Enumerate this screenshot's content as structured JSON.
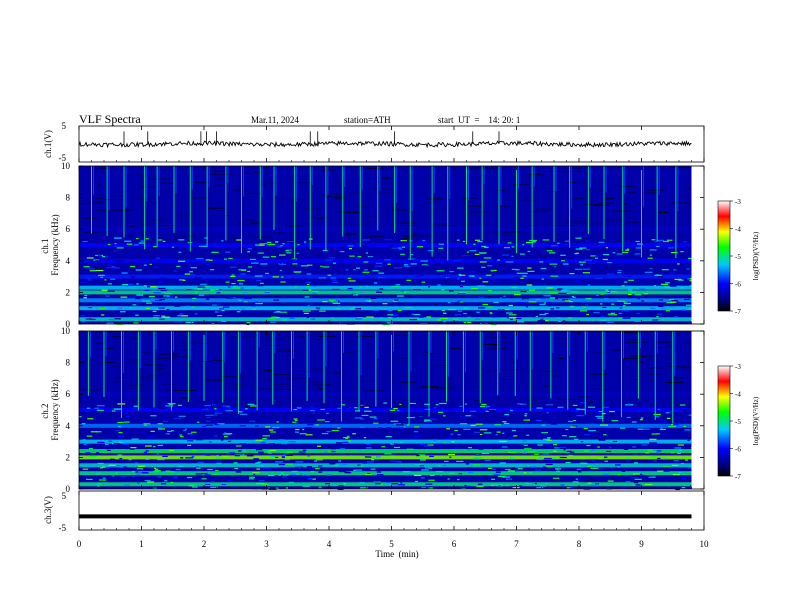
{
  "header": {
    "title": "VLF  Spectra",
    "date": "Mar.11, 2024",
    "station": "station=ATH",
    "start": "start  UT  =    14: 20: 1"
  },
  "chart_data": [
    {
      "type": "line",
      "panel": "ch1-voltage",
      "ylabel": "ch.1(V)",
      "yticks": [
        "5",
        "-5"
      ],
      "ylim": [
        -5,
        5
      ],
      "xlim": [
        0,
        10
      ],
      "series": [
        {
          "baseline": 0,
          "approx_noise": 0.6
        }
      ],
      "spikes_min": [
        0.72,
        1.1,
        1.95,
        2.04,
        2.2,
        3.7,
        3.82,
        5.05,
        6.3,
        6.72
      ]
    },
    {
      "type": "heatmap",
      "panel": "ch1-spectrogram",
      "ylabel": "ch.1\nFrequency  (kHz)",
      "yticks": [
        "10",
        "8",
        "6",
        "4",
        "2",
        "0"
      ],
      "ylim": [
        0,
        10
      ],
      "xlim": [
        0,
        9.8
      ],
      "colorbar": {
        "label": "log(PSD)(V²/Hz)",
        "ticks": [
          "-3",
          "-4",
          "-5",
          "-6",
          "-7"
        ],
        "range": [
          -7,
          -3
        ]
      },
      "bands_khz": [
        {
          "f": 0.3,
          "level": -5.2
        },
        {
          "f": 1.0,
          "level": -5.3
        },
        {
          "f": 1.5,
          "level": -5.5
        },
        {
          "f": 2.0,
          "level": -5.0
        },
        {
          "f": 2.3,
          "level": -5.3
        },
        {
          "f": 3.0,
          "level": -5.9
        },
        {
          "f": 4.0,
          "level": -6.0
        },
        {
          "f": 5.0,
          "level": -6.0
        },
        {
          "f": 6.0,
          "level": -6.3
        }
      ],
      "sferics_min": [
        0.2,
        0.45,
        0.72,
        1.05,
        1.25,
        1.52,
        1.78,
        2.05,
        2.35,
        2.6,
        2.9,
        3.12,
        3.45,
        3.7,
        3.95,
        4.22,
        4.5,
        4.78,
        5.05,
        5.3,
        5.65,
        5.9,
        6.2,
        6.45,
        6.72,
        7.0,
        7.25,
        7.6,
        7.85,
        8.15,
        8.4,
        8.7,
        9.0,
        9.25,
        9.55
      ]
    },
    {
      "type": "heatmap",
      "panel": "ch2-spectrogram",
      "ylabel": "ch.2\nFrequency  (kHz)",
      "yticks": [
        "10",
        "8",
        "6",
        "4",
        "2",
        "0"
      ],
      "ylim": [
        0,
        10
      ],
      "xlim": [
        0,
        9.8
      ],
      "colorbar": {
        "label": "log(PSD)(V²/Hz)",
        "ticks": [
          "-3",
          "-4",
          "-5",
          "-6",
          "-7"
        ],
        "range": [
          -7,
          -3
        ]
      },
      "bands_khz": [
        {
          "f": 0.3,
          "level": -5.0
        },
        {
          "f": 1.0,
          "level": -5.0
        },
        {
          "f": 1.5,
          "level": -5.2
        },
        {
          "f": 2.0,
          "level": -4.4
        },
        {
          "f": 2.4,
          "level": -4.9
        },
        {
          "f": 3.0,
          "level": -5.3
        },
        {
          "f": 4.0,
          "level": -5.6
        },
        {
          "f": 5.0,
          "level": -6.0
        },
        {
          "f": 6.0,
          "level": -6.3
        }
      ],
      "sferics_min": [
        0.15,
        0.4,
        0.68,
        0.95,
        1.2,
        1.48,
        1.75,
        2.0,
        2.3,
        2.55,
        2.85,
        3.1,
        3.4,
        3.65,
        3.92,
        4.2,
        4.48,
        4.75,
        5.0,
        5.28,
        5.6,
        5.88,
        6.15,
        6.42,
        6.7,
        6.98,
        7.22,
        7.55,
        7.82,
        8.1,
        8.38,
        8.68,
        8.95,
        9.22,
        9.5
      ]
    },
    {
      "type": "line",
      "panel": "ch3-voltage",
      "ylabel": "ch.3(V)",
      "yticks": [
        "5",
        "-5"
      ],
      "ylim": [
        -5,
        5
      ],
      "xlim": [
        0,
        10
      ],
      "series": [
        {
          "baseline": -1.5
        }
      ]
    }
  ],
  "xaxis": {
    "label": "Time  (min)",
    "ticks": [
      "0",
      "1",
      "2",
      "3",
      "4",
      "5",
      "6",
      "7",
      "8",
      "9",
      "10"
    ],
    "range": [
      0,
      10
    ]
  }
}
